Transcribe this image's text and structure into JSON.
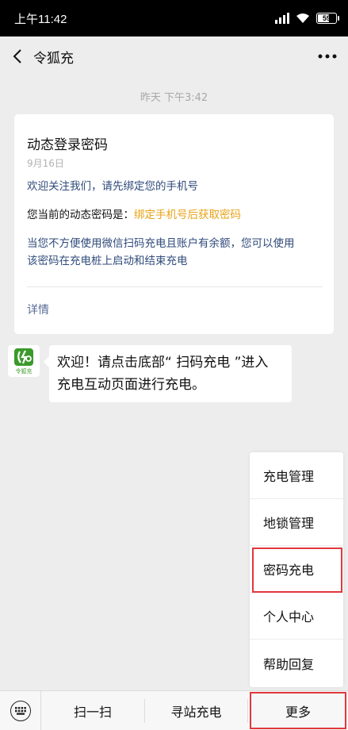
{
  "status_bar": {
    "time": "上午11:42",
    "battery_level": "59"
  },
  "nav": {
    "title": "令狐充"
  },
  "chat": {
    "timestamp": "昨天 下午3:42",
    "card": {
      "title": "动态登录密码",
      "date": "9月16日",
      "line1": "欢迎关注我们，请先绑定您的手机号",
      "password_label": "您当前的动态密码是：",
      "password_value": "绑定手机号后获取密码",
      "note_line1": "当您不方便使用微信扫码充电且账户有余额，您可以使用",
      "note_line2": "该密码在充电桩上启动和结束充电",
      "detail_link": "详情"
    },
    "avatar_label": "令狐充",
    "message_line1": "欢迎！请点击底部“ 扫码充电 ”进入",
    "message_line2": "充电互动页面进行充电。"
  },
  "popup_menu": {
    "items": [
      "充电管理",
      "地锁管理",
      "密码充电",
      "个人中心",
      "帮助回复"
    ]
  },
  "bottom_menu": {
    "items": [
      "扫一扫",
      "寻站充电",
      "更多"
    ]
  },
  "colors": {
    "link_blue": "#2f4a7a",
    "highlight_orange": "#e8a317",
    "annotation_red": "#e0383e",
    "logo_green": "#3a9a2a"
  }
}
